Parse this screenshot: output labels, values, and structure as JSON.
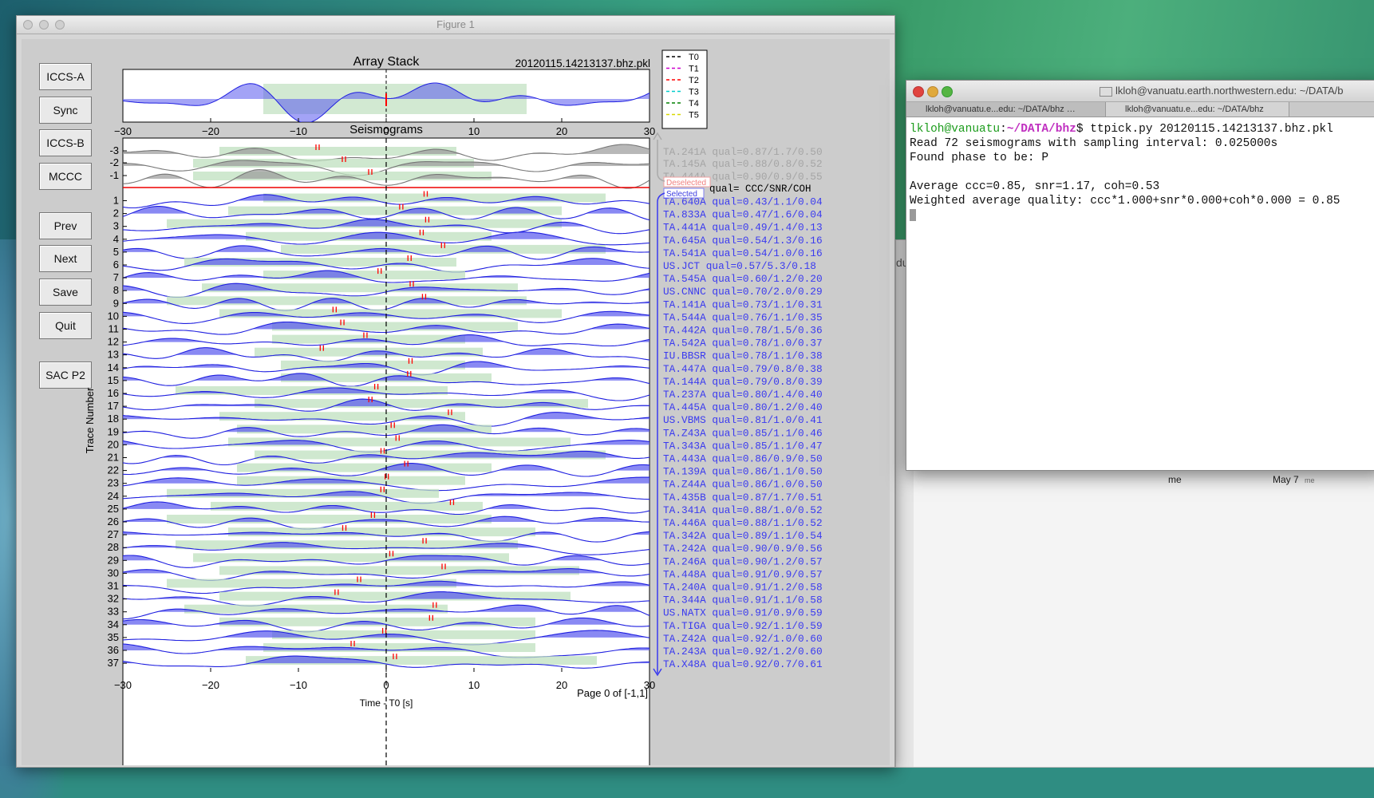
{
  "figure_window": {
    "title": "Figure 1",
    "page_label": "Page 0 of [-1,1]",
    "xlabel_partial": "Time - T0 [s]"
  },
  "buttons": [
    "ICCS-A",
    "Sync",
    "ICCS-B",
    "MCCC",
    "Prev",
    "Next",
    "Save",
    "Quit",
    "SAC P2"
  ],
  "stack_panel": {
    "title": "Array Stack",
    "filename": "20120115.14213137.bhz.pkl",
    "ticks": [
      "−30",
      "−20",
      "−10",
      "0",
      "10",
      "20",
      "30"
    ]
  },
  "legend": {
    "items": [
      {
        "label": "T0",
        "color": "#000000"
      },
      {
        "label": "T1",
        "color": "#cc00cc"
      },
      {
        "label": "T2",
        "color": "#ff0000"
      },
      {
        "label": "T3",
        "color": "#00cccc"
      },
      {
        "label": "T4",
        "color": "#008000"
      },
      {
        "label": "T5",
        "color": "#d8d800"
      }
    ]
  },
  "seis_panel": {
    "title": "Seismograms",
    "ylabel": "Trace Number",
    "ticks": [
      "−30",
      "−20",
      "−10",
      "0",
      "10",
      "20",
      "30"
    ],
    "deselected_label": "Deselected",
    "selected_label": "Selected",
    "qual_header": "qual= CCC/SNR/COH",
    "deselected": [
      {
        "num": "-3",
        "label": "TA.241A  qual=0.87/1.7/0.50"
      },
      {
        "num": "-2",
        "label": "TA.145A  qual=0.88/0.8/0.52"
      },
      {
        "num": "-1",
        "label": "TA.444A  qual=0.90/0.9/0.55"
      }
    ],
    "selected": [
      {
        "num": "1",
        "label": "TA.640A  qual=0.43/1.1/0.04"
      },
      {
        "num": "2",
        "label": "TA.833A  qual=0.47/1.6/0.04"
      },
      {
        "num": "3",
        "label": "TA.441A  qual=0.49/1.4/0.13"
      },
      {
        "num": "4",
        "label": "TA.645A  qual=0.54/1.3/0.16"
      },
      {
        "num": "5",
        "label": "TA.541A  qual=0.54/1.0/0.16"
      },
      {
        "num": "6",
        "label": "US.JCT   qual=0.57/5.3/0.18"
      },
      {
        "num": "7",
        "label": "TA.545A  qual=0.60/1.2/0.20"
      },
      {
        "num": "8",
        "label": "US.CNNC  qual=0.70/2.0/0.29"
      },
      {
        "num": "9",
        "label": "TA.141A  qual=0.73/1.1/0.31"
      },
      {
        "num": "10",
        "label": "TA.544A  qual=0.76/1.1/0.35"
      },
      {
        "num": "11",
        "label": "TA.442A  qual=0.78/1.5/0.36"
      },
      {
        "num": "12",
        "label": "TA.542A  qual=0.78/1.0/0.37"
      },
      {
        "num": "13",
        "label": "IU.BBSR  qual=0.78/1.1/0.38"
      },
      {
        "num": "14",
        "label": "TA.447A  qual=0.79/0.8/0.38"
      },
      {
        "num": "15",
        "label": "TA.144A  qual=0.79/0.8/0.39"
      },
      {
        "num": "16",
        "label": "TA.237A  qual=0.80/1.4/0.40"
      },
      {
        "num": "17",
        "label": "TA.445A  qual=0.80/1.2/0.40"
      },
      {
        "num": "18",
        "label": "US.VBMS  qual=0.81/1.0/0.41"
      },
      {
        "num": "19",
        "label": "TA.Z43A  qual=0.85/1.1/0.46"
      },
      {
        "num": "20",
        "label": "TA.343A  qual=0.85/1.1/0.47"
      },
      {
        "num": "21",
        "label": "TA.443A  qual=0.86/0.9/0.50"
      },
      {
        "num": "22",
        "label": "TA.139A  qual=0.86/1.1/0.50"
      },
      {
        "num": "23",
        "label": "TA.Z44A  qual=0.86/1.0/0.50"
      },
      {
        "num": "24",
        "label": "TA.435B  qual=0.87/1.7/0.51"
      },
      {
        "num": "25",
        "label": "TA.341A  qual=0.88/1.0/0.52"
      },
      {
        "num": "26",
        "label": "TA.446A  qual=0.88/1.1/0.52"
      },
      {
        "num": "27",
        "label": "TA.342A  qual=0.89/1.1/0.54"
      },
      {
        "num": "28",
        "label": "TA.242A  qual=0.90/0.9/0.56"
      },
      {
        "num": "29",
        "label": "TA.246A  qual=0.90/1.2/0.57"
      },
      {
        "num": "30",
        "label": "TA.448A  qual=0.91/0.9/0.57"
      },
      {
        "num": "31",
        "label": "TA.240A  qual=0.91/1.2/0.58"
      },
      {
        "num": "32",
        "label": "TA.344A  qual=0.91/1.1/0.58"
      },
      {
        "num": "33",
        "label": "US.NATX  qual=0.91/0.9/0.59"
      },
      {
        "num": "34",
        "label": "TA.TIGA  qual=0.92/1.1/0.59"
      },
      {
        "num": "35",
        "label": "TA.Z42A  qual=0.92/1.0/0.60"
      },
      {
        "num": "36",
        "label": "TA.243A  qual=0.92/1.2/0.60"
      },
      {
        "num": "37",
        "label": "TA.X48A  qual=0.92/0.7/0.61"
      }
    ]
  },
  "terminal": {
    "title": "lkloh@vanuatu.earth.northwestern.edu: ~/DATA/b",
    "tabs": [
      "lkloh@vanuatu.e...edu: ~/DATA/bhz …",
      "lkloh@vanuatu.e...edu: ~/DATA/bhz"
    ],
    "prompt_user": "lkloh@vanuatu",
    "prompt_path": "~/DATA/bhz",
    "command": "$ ttpick.py 20120115.14213137.bhz.pkl",
    "lines": [
      "Read 72 seismograms with sampling interval: 0.025000s",
      "Found phase to be: P",
      "",
      "Average ccc=0.85, snr=1.17, coh=0.53",
      "Weighted average quality: ccc*1.000+snr*0.000+coh*0.000 = 0.85"
    ]
  },
  "background_window": {
    "col_me": "me",
    "col_date": "May 7",
    "col_small": "me",
    "partial": "du"
  },
  "colors": {
    "trace_fill": "#5757ee",
    "trace_line": "#1f1fe0",
    "window_fill": "#bfe0bf",
    "deselected_fill": "#9a9a9a",
    "pick_red": "#ff0000",
    "term_green": "#1c9c1c",
    "term_magenta": "#c030c0"
  }
}
